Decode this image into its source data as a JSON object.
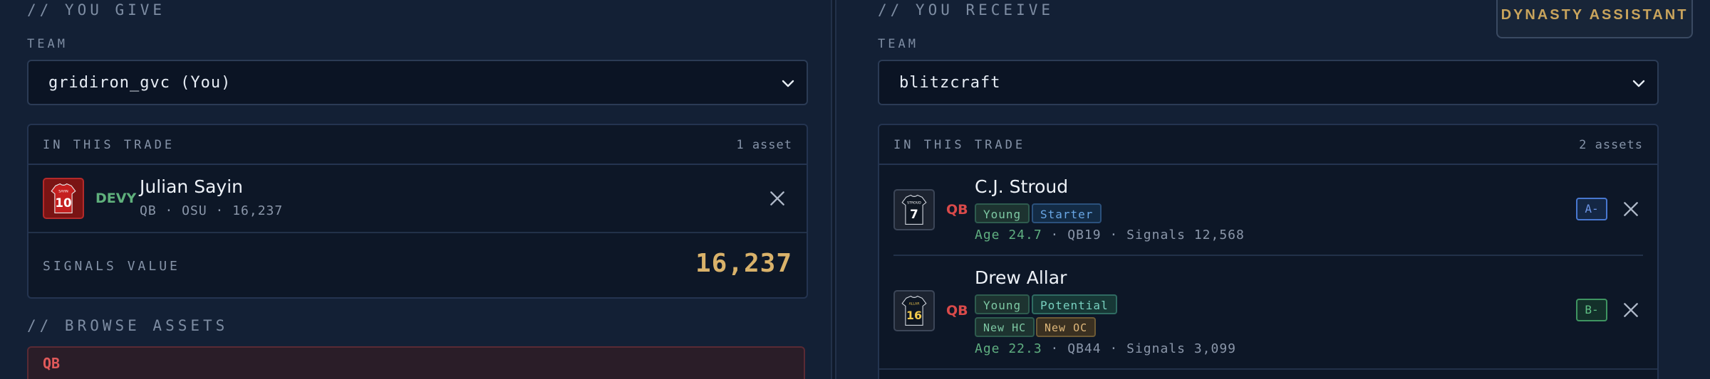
{
  "give": {
    "section_title": "// YOU GIVE",
    "team_label": "TEAM",
    "team_value": "gridiron_gvc (You)",
    "trade_header": "IN THIS TRADE",
    "asset_count": "1 asset",
    "players": [
      {
        "tier": "DEVY",
        "name": "Julian Sayin",
        "meta": "QB · OSU · 16,237",
        "jersey_number": "10",
        "jersey_name": "SAYIN"
      }
    ],
    "signals_label": "SIGNALS VALUE",
    "signals_value": "16,237",
    "browse_title": "// BROWSE ASSETS",
    "browse_group": "QB"
  },
  "receive": {
    "section_title": "// YOU RECEIVE",
    "team_label": "TEAM",
    "team_value": "blitzcraft",
    "trade_header": "IN THIS TRADE",
    "asset_count": "2 assets",
    "players": [
      {
        "position": "QB",
        "name": "C.J. Stroud",
        "tags": [
          "Young",
          "Starter"
        ],
        "age": "Age 24.7",
        "rank": "QB19",
        "signals": "Signals 12,568",
        "grade": "A-",
        "jersey_number": "7",
        "jersey_name": "STROUD"
      },
      {
        "position": "QB",
        "name": "Drew Allar",
        "tags": [
          "Young",
          "Potential"
        ],
        "tags2": [
          "New HC",
          "New OC"
        ],
        "age": "Age 22.3",
        "rank": "QB44",
        "signals": "Signals 3,099",
        "grade": "B-",
        "jersey_number": "16",
        "jersey_name": "ALLAR"
      }
    ]
  },
  "assistant_button": "DYNASTY ASSISTANT",
  "meta_separator": "·",
  "icons": {
    "chevron": "chevron-down-icon",
    "remove": "close-icon"
  },
  "colors": {
    "accent_gold": "#d9b26a",
    "position_red": "#d94a4a",
    "devy_green": "#5fb07c",
    "grade_a_blue": "#4878d0",
    "grade_b_green": "#3f9561"
  }
}
